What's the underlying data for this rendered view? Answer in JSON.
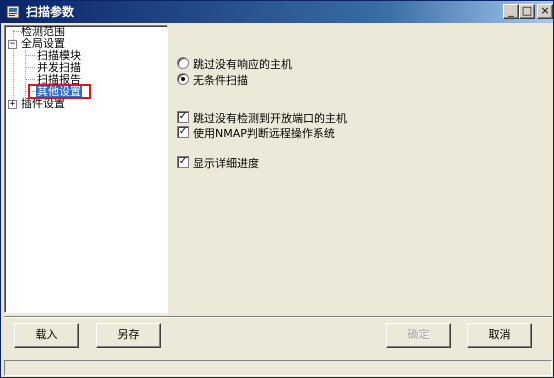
{
  "window": {
    "title": "扫描参数",
    "controls": {
      "minimize": "_",
      "maximize": "□",
      "close": "×"
    }
  },
  "tree": {
    "nodes": [
      {
        "label": "检测范围"
      },
      {
        "label": "全局设置",
        "expander": "−"
      },
      {
        "label": "扫描模块"
      },
      {
        "label": "并发扫描"
      },
      {
        "label": "扫描报告"
      },
      {
        "label": "其他设置",
        "selected": true
      },
      {
        "label": "插件设置",
        "expander": "+"
      }
    ]
  },
  "options": {
    "radios": [
      {
        "label": "跳过没有响应的主机",
        "checked": false
      },
      {
        "label": "无条件扫描",
        "checked": true
      }
    ],
    "checkboxes": [
      {
        "label": "跳过没有检测到开放端口的主机",
        "checked": true
      },
      {
        "label": "使用NMAP判断远程操作系统",
        "checked": true
      },
      {
        "label": "显示详细进度",
        "checked": true
      }
    ],
    "check_mark": "✓"
  },
  "buttons": {
    "load": "载入",
    "save_as": "另存",
    "ok": "确定",
    "cancel": "取消"
  },
  "colors": {
    "titlebar_start": "#0a246a",
    "selection": "#316ac5",
    "annotation_box": "#e0141e"
  }
}
